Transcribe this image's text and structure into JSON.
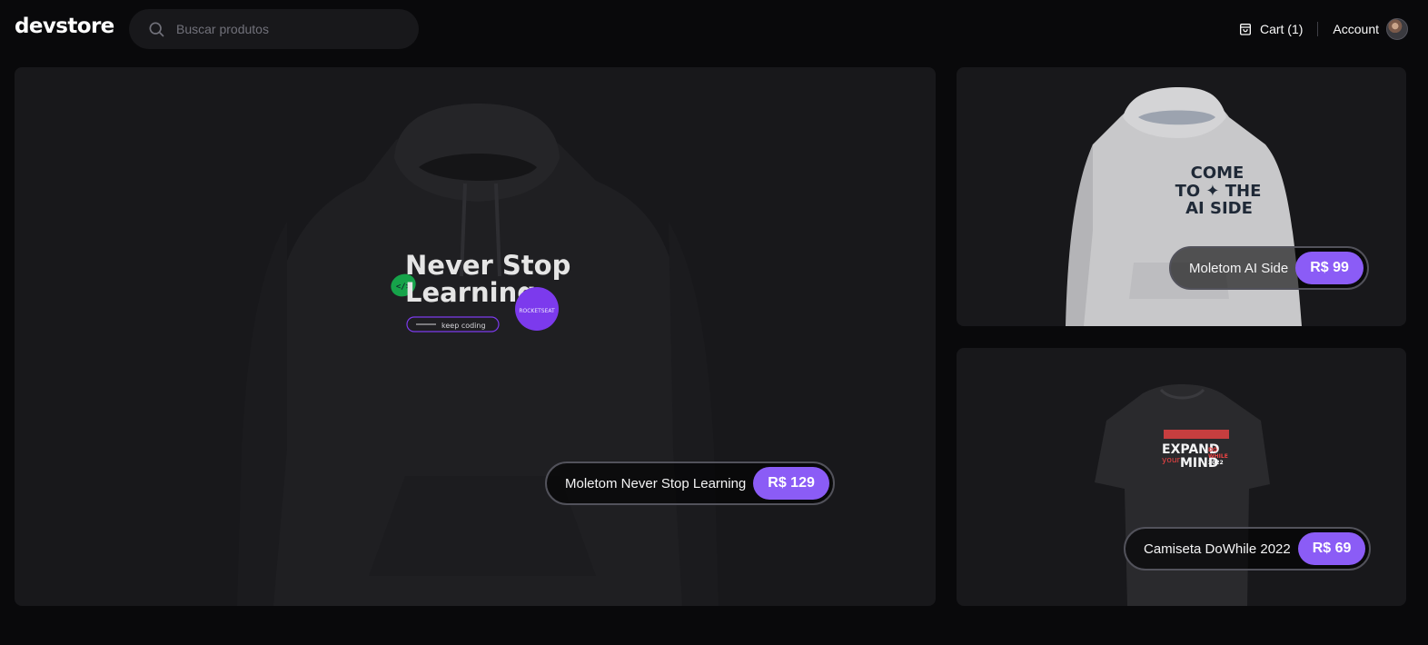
{
  "header": {
    "logo": "devstore",
    "search": {
      "placeholder": "Buscar produtos",
      "value": ""
    },
    "cart_label": "Cart (1)",
    "account_label": "Account"
  },
  "products": [
    {
      "name": "Moletom Never Stop Learning",
      "price": "R$ 129",
      "print": {
        "line1": "Never Stop",
        "line2": "Learning",
        "tag": "keep coding",
        "badge": "ROCKETSEAT",
        "sticker": "</>"
      }
    },
    {
      "name": "Moletom AI Side",
      "price": "R$ 99",
      "print": {
        "line1": "COME",
        "line2": "TO ✦ THE",
        "line3": "AI SIDE"
      }
    },
    {
      "name": "Camiseta DoWhile 2022",
      "price": "R$ 69",
      "print": {
        "line1": "EXPAND",
        "line2": "your",
        "line3": "MIND",
        "side1": "DO",
        "side2": "WHILE",
        "side3": "2022"
      }
    }
  ],
  "colors": {
    "background": "#09090b",
    "card": "#18181b",
    "accent": "#8b5cf6",
    "badge": "#7c3aed",
    "sticker": "#16a34a",
    "print_red": "#ef4444"
  },
  "icons": {
    "search": "search-icon",
    "cart": "shopping-bag-icon",
    "avatar": "avatar"
  }
}
